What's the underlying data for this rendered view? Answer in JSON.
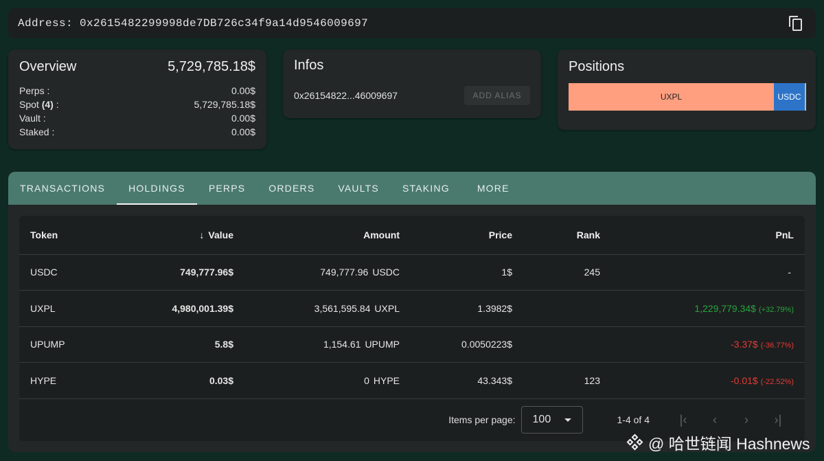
{
  "address_bar": {
    "label": "Address:",
    "address": "0x2615482299998de7DB726c34f9a14d9546009697"
  },
  "overview": {
    "title": "Overview",
    "total": "5,729,785.18$",
    "rows": [
      {
        "label": "Perps :",
        "value": "0.00$"
      },
      {
        "label": "Spot",
        "count": "(4)",
        "suffix": ":",
        "value": "5,729,785.18$"
      },
      {
        "label": "Vault :",
        "value": "0.00$"
      },
      {
        "label": "Staked :",
        "value": "0.00$"
      }
    ]
  },
  "infos": {
    "title": "Infos",
    "short_address": "0x26154822...46009697",
    "alias_button": "ADD ALIAS"
  },
  "positions": {
    "title": "Positions",
    "segments": [
      {
        "label": "UXPL",
        "share": 0.8689,
        "color": "#ff9f7f"
      },
      {
        "label": "USDC",
        "share": 0.1309,
        "color": "#2d74c9"
      }
    ]
  },
  "tabs": [
    "TRANSACTIONS",
    "HOLDINGS",
    "PERPS",
    "ORDERS",
    "VAULTS",
    "STAKING",
    "MORE"
  ],
  "active_tab": "HOLDINGS",
  "table": {
    "headers": {
      "token": "Token",
      "value": "Value",
      "amount": "Amount",
      "price": "Price",
      "rank": "Rank",
      "pnl": "PnL"
    },
    "sort_arrow": "↓",
    "rows": [
      {
        "token": "USDC",
        "value": "749,777.96$",
        "amount": "749,777.96",
        "amount_unit": "USDC",
        "price": "1$",
        "rank": "245",
        "pnl": "-",
        "pnl_pct": "",
        "pnl_sign": "none"
      },
      {
        "token": "UXPL",
        "value": "4,980,001.39$",
        "amount": "3,561,595.84",
        "amount_unit": "UXPL",
        "price": "1.3982$",
        "rank": "",
        "pnl": "1,229,779.34$",
        "pnl_pct": "(+32.79%)",
        "pnl_sign": "positive"
      },
      {
        "token": "UPUMP",
        "value": "5.8$",
        "amount": "1,154.61",
        "amount_unit": "UPUMP",
        "price": "0.0050223$",
        "rank": "",
        "pnl": "-3.37$",
        "pnl_pct": "(-36.77%)",
        "pnl_sign": "negative"
      },
      {
        "token": "HYPE",
        "value": "0.03$",
        "amount": "0",
        "amount_unit": "HYPE",
        "price": "43.343$",
        "rank": "123",
        "pnl": "-0.01$",
        "pnl_pct": "(-22.52%)",
        "pnl_sign": "negative"
      }
    ]
  },
  "pagination": {
    "items_per_page_label": "Items per page:",
    "items_per_page": "100",
    "range": "1-4 of 4",
    "first_icon": "first-page-icon",
    "prev_icon": "chevron-left-icon",
    "next_icon": "chevron-right-icon",
    "last_icon": "last-page-icon"
  },
  "watermark": {
    "text": "@ 哈世链闻 Hashnews"
  },
  "colors": {
    "background": "#0f2a23",
    "tab_bar": "#4a7a6d",
    "pnl_positive": "#27a53f",
    "pnl_negative": "#e53935"
  }
}
